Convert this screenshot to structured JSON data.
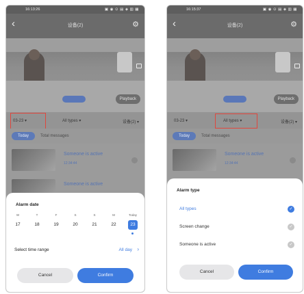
{
  "left": {
    "status": {
      "time": "16:13:26",
      "icons": "▣ ◉ ⊙ ▤ ◈ ▥ ▦"
    },
    "title": "设备(2)",
    "playback": "Playback",
    "filters": {
      "date": "03-23 ▾",
      "type": "All types ▾",
      "device": "设备(2) ▾"
    },
    "tabs": {
      "today": "Today",
      "all": "Total messages"
    },
    "events": [
      {
        "title": "Someone is active",
        "time": "12:34:44"
      },
      {
        "title": "Someone is active",
        "time": ""
      }
    ],
    "sheet": {
      "title": "Alarm date",
      "days": [
        {
          "name": "W",
          "date": "17"
        },
        {
          "name": "T",
          "date": "18"
        },
        {
          "name": "F",
          "date": "19"
        },
        {
          "name": "S",
          "date": "20"
        },
        {
          "name": "S",
          "date": "21"
        },
        {
          "name": "M",
          "date": "22"
        },
        {
          "name": "Today",
          "date": "23"
        }
      ],
      "range_label": "Select time range",
      "range_value": "All day",
      "cancel": "Cancel",
      "confirm": "Confirm"
    }
  },
  "right": {
    "status": {
      "time": "16:15:37",
      "icons": "▣ ◉ ⊙ ▤ ◈ ▥ ▦"
    },
    "title": "设备(2)",
    "playback": "Playback",
    "filters": {
      "date": "03-23 ▾",
      "type": "All types ▾",
      "device": "设备(2) ▾"
    },
    "tabs": {
      "today": "Today",
      "all": "Total messages"
    },
    "events": [
      {
        "title": "Someone is active",
        "time": "12:34:44"
      }
    ],
    "sheet": {
      "title": "Alarm type",
      "types": [
        {
          "label": "All types",
          "selected": true
        },
        {
          "label": "Screen change",
          "selected": false
        },
        {
          "label": "Someone is active",
          "selected": false
        }
      ],
      "cancel": "Cancel",
      "confirm": "Confirm"
    }
  },
  "colors": {
    "accent": "#3f7ce0",
    "highlight": "#e0463c"
  }
}
